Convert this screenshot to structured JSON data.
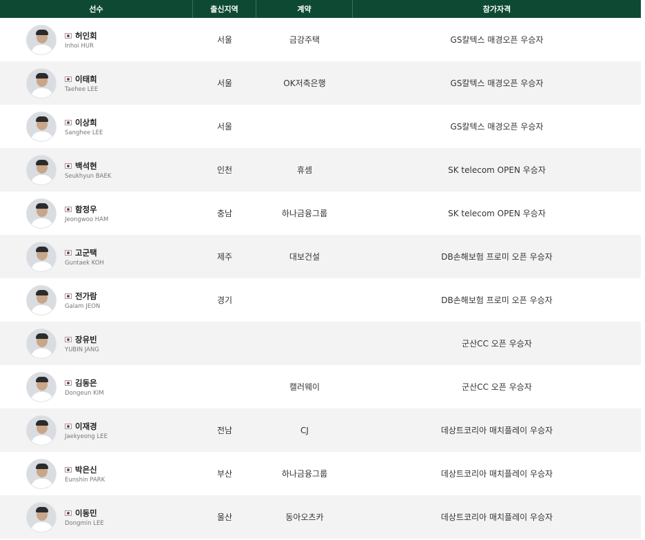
{
  "columns": {
    "player": "선수",
    "region": "출신지역",
    "contract": "계약",
    "qualification": "참가자격"
  },
  "players": [
    {
      "kname": "허인회",
      "ename": "Inhoi HUR",
      "region": "서울",
      "contract": "금강주택",
      "qualification": "GS칼텍스 매경오픈 우승자"
    },
    {
      "kname": "이태희",
      "ename": "Taehee LEE",
      "region": "서울",
      "contract": "OK저축은행",
      "qualification": "GS칼텍스 매경오픈 우승자"
    },
    {
      "kname": "이상희",
      "ename": "Sanghee LEE",
      "region": "서울",
      "contract": "",
      "qualification": "GS칼텍스 매경오픈 우승자"
    },
    {
      "kname": "백석현",
      "ename": "Seukhyun BAEK",
      "region": "인천",
      "contract": "휴셈",
      "qualification": "SK telecom OPEN 우승자"
    },
    {
      "kname": "함정우",
      "ename": "Jeongwoo HAM",
      "region": "충남",
      "contract": "하나금융그룹",
      "qualification": "SK telecom OPEN 우승자"
    },
    {
      "kname": "고군택",
      "ename": "Guntaek KOH",
      "region": "제주",
      "contract": "대보건설",
      "qualification": "DB손해보험 프로미 오픈 우승자"
    },
    {
      "kname": "전가람",
      "ename": "Galam JEON",
      "region": "경기",
      "contract": "",
      "qualification": "DB손해보험 프로미 오픈 우승자"
    },
    {
      "kname": "장유빈",
      "ename": "YUBIN JANG",
      "region": "",
      "contract": "",
      "qualification": "군산CC 오픈 우승자"
    },
    {
      "kname": "김동은",
      "ename": "Dongeun KIM",
      "region": "",
      "contract": "캘러웨이",
      "qualification": "군산CC 오픈 우승자"
    },
    {
      "kname": "이재경",
      "ename": "Jaekyeong LEE",
      "region": "전남",
      "contract": "CJ",
      "qualification": "데상트코리아 매치플레이 우승자"
    },
    {
      "kname": "박은신",
      "ename": "Eunshin PARK",
      "region": "부산",
      "contract": "하나금융그룹",
      "qualification": "데상트코리아 매치플레이 우승자"
    },
    {
      "kname": "이동민",
      "ename": "Dongmin LEE",
      "region": "울산",
      "contract": "동아오츠카",
      "qualification": "데상트코리아 매치플레이 우승자"
    }
  ],
  "colors": {
    "header_bg": "#0e4a33",
    "row_alt": "#f3f3f3"
  }
}
